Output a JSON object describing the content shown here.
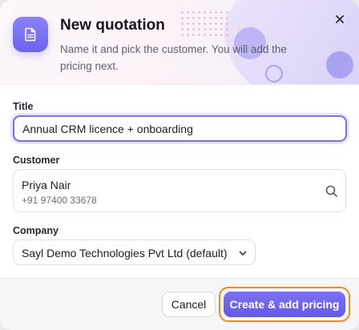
{
  "header": {
    "title": "New quotation",
    "subtitle": "Name it and pick the customer. You will add the pricing next.",
    "icon": "document-icon",
    "close_icon": "close-icon"
  },
  "form": {
    "title_label": "Title",
    "title_value": "Annual CRM licence + onboarding",
    "customer_label": "Customer",
    "customer_name": "Priya Nair",
    "customer_phone": "+91 97400 33678",
    "customer_icon": "search-icon",
    "company_label": "Company",
    "company_value": "Sayl Demo Technologies Pvt Ltd (default)",
    "company_icon": "chevron-down-icon"
  },
  "footer": {
    "cancel_label": "Cancel",
    "create_label": "Create & add pricing"
  },
  "colors": {
    "accent": "#6d62ee",
    "focus_ring": "#f08a2c",
    "muted_text": "#5f6070"
  }
}
